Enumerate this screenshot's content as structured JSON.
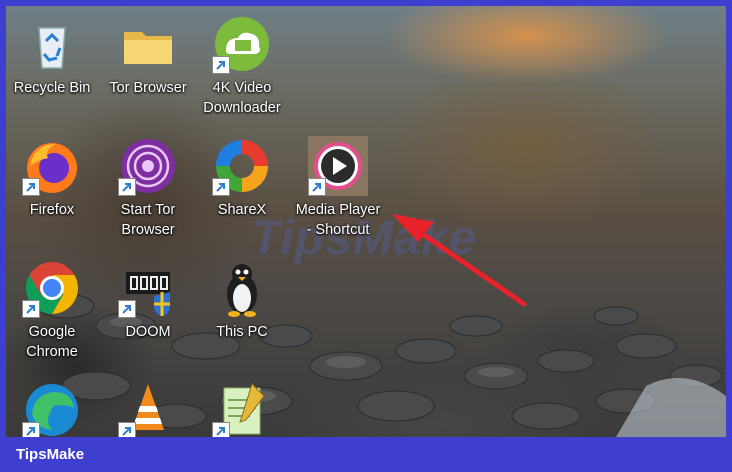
{
  "icons": [
    {
      "label": "Recycle Bin",
      "icon": "recycle-bin-icon"
    },
    {
      "label": "Tor Browser",
      "icon": "folder-icon"
    },
    {
      "label": "4K Video Downloader",
      "icon": "4k-video-downloader-icon"
    },
    {
      "label": "Firefox",
      "icon": "firefox-icon"
    },
    {
      "label": "Start Tor Browser",
      "icon": "tor-browser-icon"
    },
    {
      "label": "ShareX",
      "icon": "sharex-icon"
    },
    {
      "label": "Media Player - Shortcut",
      "icon": "media-player-icon"
    },
    {
      "label": "Google Chrome",
      "icon": "chrome-icon"
    },
    {
      "label": "DOOM",
      "icon": "doom-icon"
    },
    {
      "label": "This PC",
      "icon": "this-pc-icon"
    }
  ],
  "watermark": "TipsMake",
  "footer": "TipsMake",
  "colors": {
    "frame": "#3f3fcf",
    "arrow": "#e8222a"
  }
}
